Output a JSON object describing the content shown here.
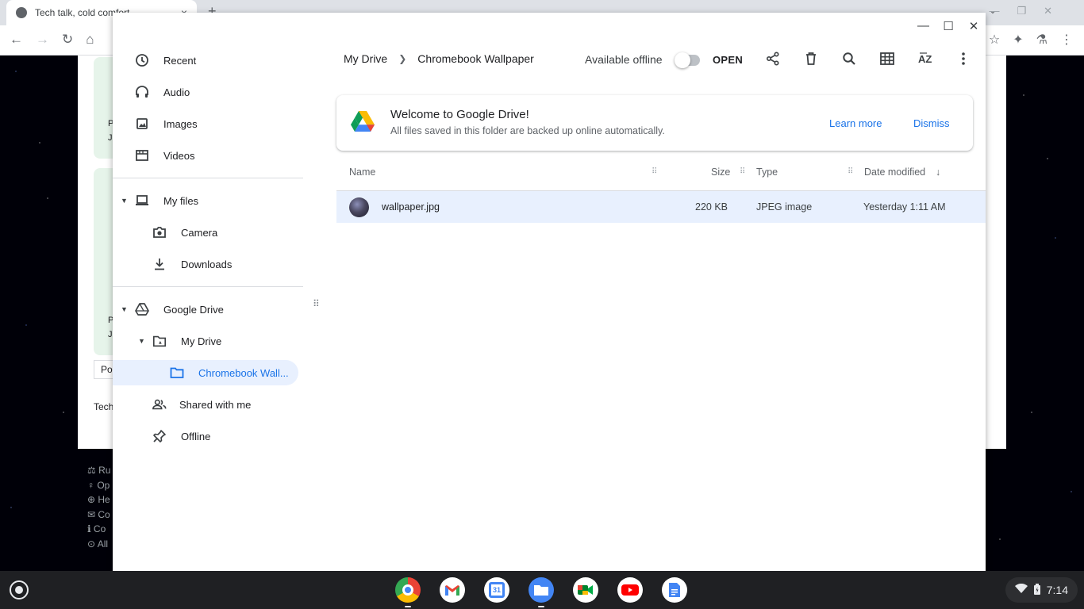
{
  "browser": {
    "tab_title": "Tech talk, cold comfort",
    "tab_close": "×",
    "new_tab": "+",
    "page_fragments": {
      "card1_line1": "P",
      "card1_line2": "J",
      "card2_line1": "P",
      "card2_line2": "J",
      "post_box": "Po",
      "tech": "Tech"
    },
    "footer_fragments": [
      "Ru",
      "Op",
      "He",
      "Co",
      "Co",
      "All"
    ]
  },
  "files": {
    "sidebar": {
      "recent": "Recent",
      "audio": "Audio",
      "images": "Images",
      "videos": "Videos",
      "my_files": "My files",
      "camera": "Camera",
      "downloads": "Downloads",
      "google_drive": "Google Drive",
      "my_drive": "My Drive",
      "chromebook_wallpaper": "Chromebook Wall...",
      "shared_with_me": "Shared with me",
      "offline": "Offline"
    },
    "breadcrumb": {
      "root": "My Drive",
      "current": "Chromebook Wallpaper"
    },
    "toolbar": {
      "available_offline": "Available offline",
      "open": "OPEN"
    },
    "banner": {
      "title": "Welcome to Google Drive!",
      "subtitle": "All files saved in this folder are backed up online automatically.",
      "learn_more": "Learn more",
      "dismiss": "Dismiss"
    },
    "table": {
      "headers": {
        "name": "Name",
        "size": "Size",
        "type": "Type",
        "date_modified": "Date modified"
      },
      "rows": [
        {
          "name": "wallpaper.jpg",
          "size": "220 KB",
          "type": "JPEG image",
          "date": "Yesterday 1:11 AM"
        }
      ]
    }
  },
  "shelf": {
    "calendar_day": "31",
    "clock": "7:14"
  },
  "colors": {
    "accent": "#1a73e8",
    "selection": "#e8f0fe"
  }
}
